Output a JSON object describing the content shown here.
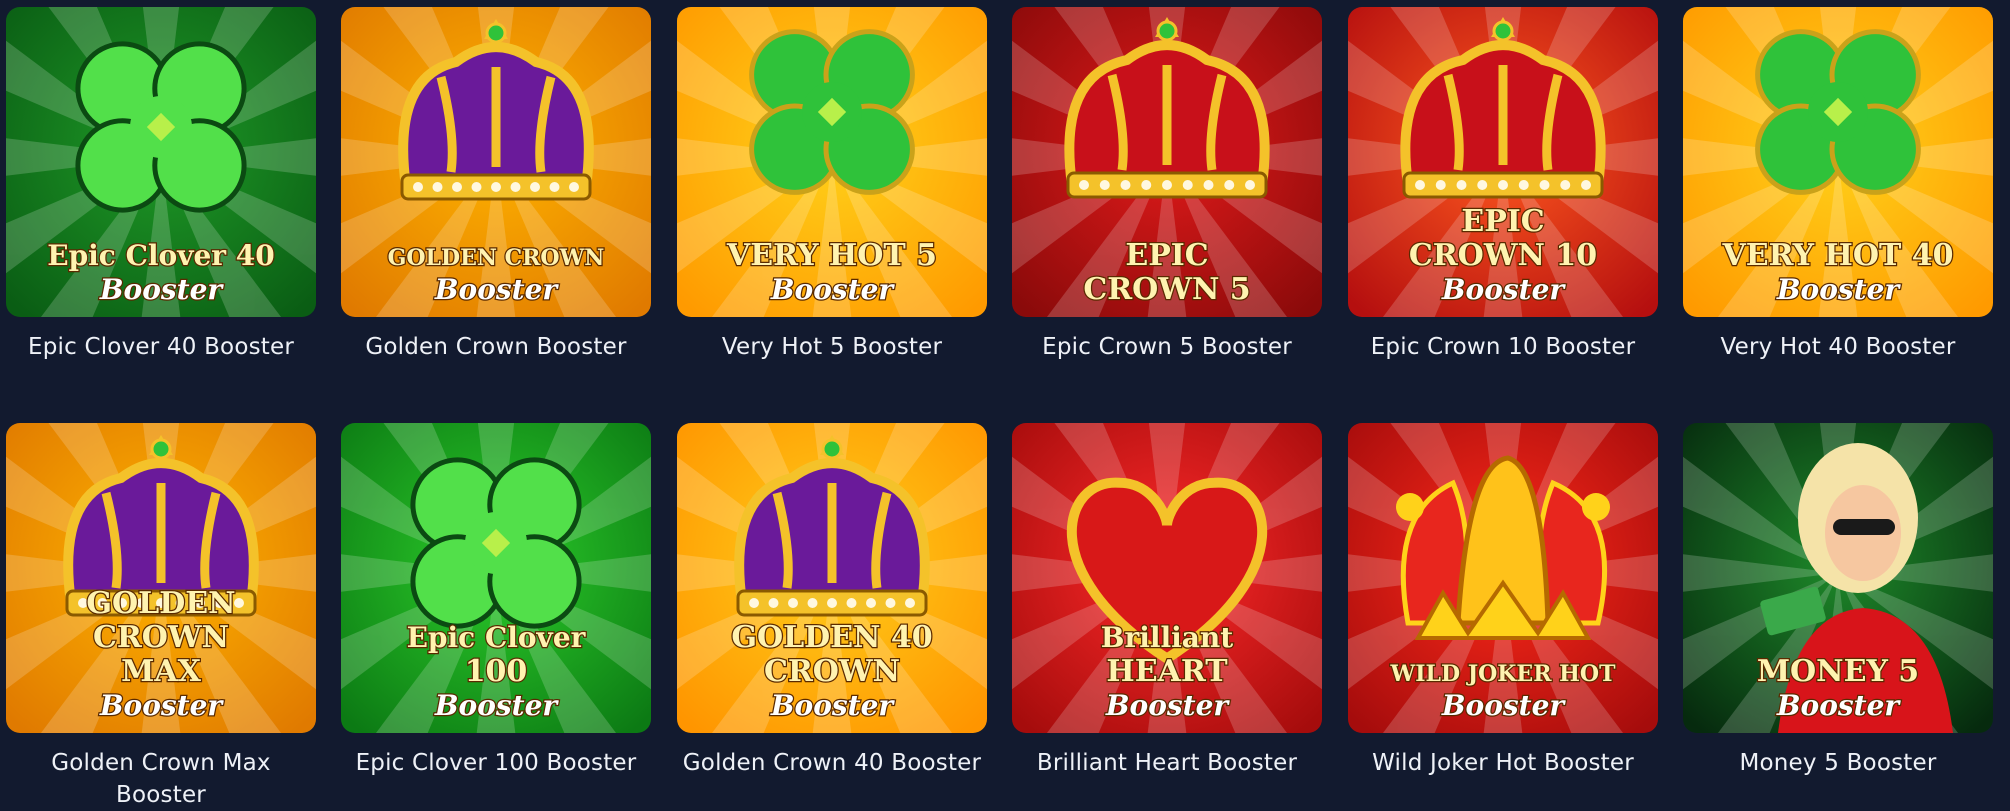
{
  "games": [
    {
      "title": "Epic Clover 40 Booster",
      "art": "clover",
      "logo_lines": [
        "Epic Clover 40",
        "Booster"
      ],
      "bg": [
        "#1f9a27",
        "#0a5d14"
      ],
      "accent": "#52e04a"
    },
    {
      "title": "Golden Crown Booster",
      "art": "crown-purple",
      "logo_lines": [
        "GOLDEN CROWN",
        "Booster"
      ],
      "bg": [
        "#ffb300",
        "#e07a00"
      ],
      "accent": "#6a1a9a"
    },
    {
      "title": "Very Hot 5 Booster",
      "art": "clover-gold",
      "logo_lines": [
        "VERY HOT 5",
        "Booster"
      ],
      "bg": [
        "#ffd21a",
        "#ff9a00"
      ],
      "accent": "#2fc23a"
    },
    {
      "title": "Epic Crown 5 Booster",
      "art": "crown-red",
      "logo_lines": [
        "EPIC",
        "CROWN 5"
      ],
      "bg": [
        "#e31b1b",
        "#8a0a0a"
      ],
      "accent": "#f2c230"
    },
    {
      "title": "Epic Crown 10 Booster",
      "art": "crown-red",
      "logo_lines": [
        "EPIC",
        "CROWN 10",
        "Booster"
      ],
      "bg": [
        "#ff5a1f",
        "#b50f0f"
      ],
      "accent": "#f2c230"
    },
    {
      "title": "Very Hot 40 Booster",
      "art": "clover-gold",
      "logo_lines": [
        "VERY HOT 40",
        "Booster"
      ],
      "bg": [
        "#ffd21a",
        "#ff9a00"
      ],
      "accent": "#2fc23a"
    },
    {
      "title": "Golden Crown Max Booster",
      "art": "crown-purple",
      "logo_lines": [
        "GOLDEN",
        "CROWN",
        "MAX",
        "Booster"
      ],
      "bg": [
        "#ffb300",
        "#e07a00"
      ],
      "accent": "#6a1a9a"
    },
    {
      "title": "Epic Clover 100 Booster",
      "art": "clover",
      "logo_lines": [
        "Epic Clover",
        "100",
        "Booster"
      ],
      "bg": [
        "#2ccd2a",
        "#0c7a14"
      ],
      "accent": "#52e04a"
    },
    {
      "title": "Golden Crown 40 Booster",
      "art": "crown-purple",
      "logo_lines": [
        "GOLDEN 40",
        "CROWN",
        "Booster"
      ],
      "bg": [
        "#ffce1a",
        "#ff9500"
      ],
      "accent": "#6a1a9a"
    },
    {
      "title": "Brilliant Heart Booster",
      "art": "heart",
      "logo_lines": [
        "Brilliant",
        "HEART",
        "Booster"
      ],
      "bg": [
        "#ff2a2a",
        "#a50c0c"
      ],
      "accent": "#f2c230"
    },
    {
      "title": "Wild Joker Hot Booster",
      "art": "jester",
      "logo_lines": [
        "WILD JOKER HOT",
        "Booster"
      ],
      "bg": [
        "#ff2a1a",
        "#a50c0c"
      ],
      "accent": "#ffd21a"
    },
    {
      "title": "Money 5 Booster",
      "art": "money",
      "logo_lines": [
        "MONEY 5",
        "Booster"
      ],
      "bg": [
        "#1e8a2a",
        "#062a0e"
      ],
      "accent": "#44e03a"
    }
  ]
}
